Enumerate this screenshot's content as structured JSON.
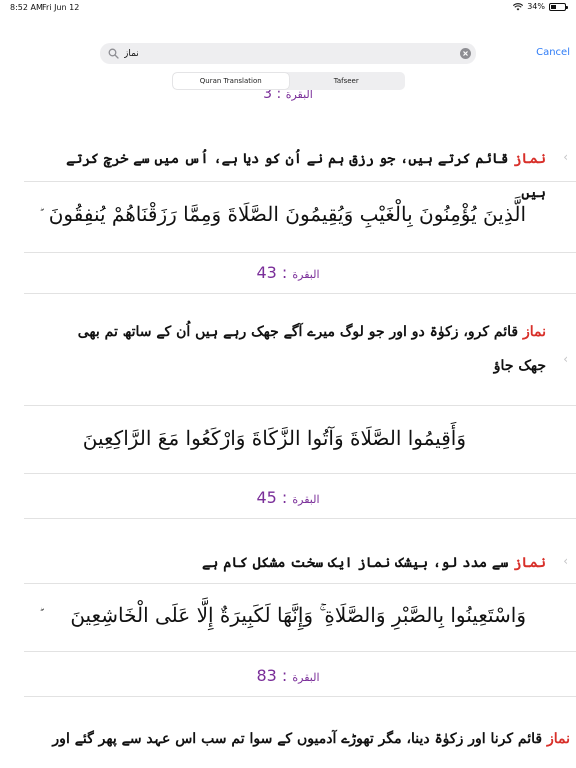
{
  "status_bar": {
    "time": "8:52 AM",
    "date": "Fri Jun 12",
    "battery": "34%",
    "battery_level": 0.34
  },
  "search": {
    "value": "نماز",
    "cancel_label": "Cancel"
  },
  "tabs": [
    {
      "label": "Quran Translation",
      "active": true
    },
    {
      "label": "Tafseer",
      "active": false
    }
  ],
  "top_ref": {
    "sura": "البقرة",
    "sep": " : ",
    "num": "3"
  },
  "results": [
    {
      "keyword": "نماز",
      "translation": " قائم کرتے ہیں، جو رزق ہم نے اُن کو دیا ہے، اُس میں سے خرچ کرتے ہیں",
      "arabic": "الَّذِينَ يُؤْمِنُونَ بِالْغَيْبِ وَيُقِيمُونَ الصَّلَاةَ وَمِمَّا رَزَقْنَاهُمْ يُنفِقُونَ"
    },
    {
      "sura": "البقرة",
      "sep": " : ",
      "num": "43",
      "keyword": "نماز",
      "translation": " قائم کرو، زکوٰۃ دو اور جو لوگ میرے آگے جھک رہے ہیں اُن کے ساتھ تم بھی جھک جاؤ",
      "arabic": "وَأَقِيمُوا الصَّلَاةَ وَآتُوا الزَّكَاةَ وَارْكَعُوا مَعَ الرَّاكِعِينَ"
    },
    {
      "sura": "البقرة",
      "sep": " : ",
      "num": "45",
      "keyword": "نماز",
      "translation": " سے مدد لو، بیشک نماز ایک سخت مشکل کام ہے",
      "arabic": "وَاسْتَعِينُوا بِالصَّبْرِ وَالصَّلَاةِ ۚ وَإِنَّهَا لَكَبِيرَةٌ إِلَّا عَلَى الْخَاشِعِينَ"
    },
    {
      "sura": "البقرة",
      "sep": " : ",
      "num": "83",
      "keyword": "نماز",
      "translation": " قائم کرنا اور زکوٰۃ دینا، مگر تھوڑے آدمیوں کے سوا تم سب اس عہد سے پھر گئے اور"
    }
  ],
  "verse_mark": "ۖ"
}
